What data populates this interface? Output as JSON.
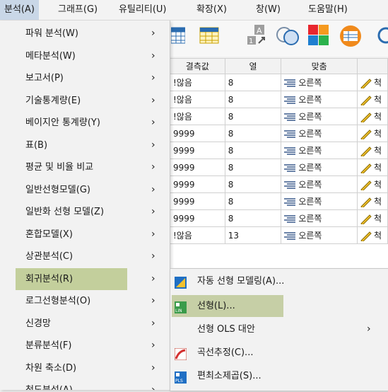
{
  "menubar": {
    "items": [
      "분석(A)",
      "그래프(G)",
      "유틸리티(U)",
      "확장(X)",
      "창(W)",
      "도움말(H)"
    ]
  },
  "grid": {
    "headers": [
      "결측값",
      "열",
      "맞춤",
      ""
    ],
    "rows": [
      [
        "!않음",
        "8",
        "오른쪽",
        "척"
      ],
      [
        "!않음",
        "8",
        "오른쪽",
        "척"
      ],
      [
        "!않음",
        "8",
        "오른쪽",
        "척"
      ],
      [
        "9999",
        "8",
        "오른쪽",
        "척"
      ],
      [
        "9999",
        "8",
        "오른쪽",
        "척"
      ],
      [
        "9999",
        "8",
        "오른쪽",
        "척"
      ],
      [
        "9999",
        "8",
        "오른쪽",
        "척"
      ],
      [
        "9999",
        "8",
        "오른쪽",
        "척"
      ],
      [
        "9999",
        "8",
        "오른쪽",
        "척"
      ],
      [
        "!않음",
        "13",
        "오른쪽",
        "척"
      ]
    ]
  },
  "menu": {
    "items": [
      {
        "label": "파워 분석(W)",
        "submenu": true
      },
      {
        "label": "메타분석(W)",
        "submenu": true
      },
      {
        "label": "보고서(P)",
        "submenu": true
      },
      {
        "label": "기술통계량(E)",
        "submenu": true
      },
      {
        "label": "베이지안 통계량(Y)",
        "submenu": true
      },
      {
        "label": "표(B)",
        "submenu": true
      },
      {
        "label": "평균 및 비율 비교",
        "submenu": true
      },
      {
        "label": "일반선형모델(G)",
        "submenu": true
      },
      {
        "label": "일반화 선형 모델(Z)",
        "submenu": true
      },
      {
        "label": "혼합모델(X)",
        "submenu": true
      },
      {
        "label": "상관분석(C)",
        "submenu": true
      },
      {
        "label": "회귀분석(R)",
        "submenu": true,
        "highlighted": true
      },
      {
        "label": "로그선형분석(O)",
        "submenu": true
      },
      {
        "label": "신경망",
        "submenu": true
      },
      {
        "label": "분류분석(F)",
        "submenu": true
      },
      {
        "label": "차원 축소(D)",
        "submenu": true
      },
      {
        "label": "척도분석(A)",
        "submenu": true
      }
    ],
    "arrow": "›"
  },
  "submenu": {
    "items": [
      {
        "label": "자동 선형 모델링(A)...",
        "icon": "auto-linear-modeling-icon"
      },
      {
        "label": "선형(L)...",
        "icon": "linear-regression-icon",
        "highlighted": true
      },
      {
        "label": "선형 OLS 대안",
        "submenu": true
      },
      {
        "label": "곡선추정(C)...",
        "icon": "curve-estimation-icon"
      },
      {
        "label": "편최소제곱(S)...",
        "icon": "partial-least-squares-icon"
      }
    ],
    "arrow": "›"
  },
  "colors": {
    "menu_highlight": "#c6cfa6",
    "menubar_active": "#c9d7e7",
    "menu_bg": "#f2f2f2"
  }
}
